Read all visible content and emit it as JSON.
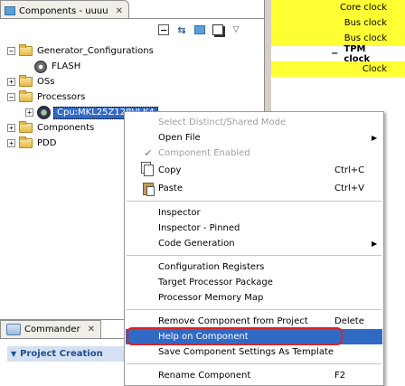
{
  "components_view": {
    "tab_title": "Components - uuuu",
    "close_glyph": "✕",
    "toolbar": [
      {
        "icon": "collapse-all-icon"
      },
      {
        "icon": "link-with-editor-icon",
        "glyph": "⇆"
      },
      {
        "icon": "new-folder-icon"
      },
      {
        "icon": "stack-icon"
      },
      {
        "icon": "view-menu-icon",
        "glyph": "▽"
      }
    ],
    "tree": [
      {
        "label": "Generator_Configurations",
        "expander": "−",
        "icon": "folder-icon",
        "level": 0
      },
      {
        "label": "FLASH",
        "expander": "",
        "icon": "gear-icon",
        "level": 1
      },
      {
        "label": "OSs",
        "expander": "+",
        "icon": "folder-icon",
        "level": 0
      },
      {
        "label": "Processors",
        "expander": "−",
        "icon": "folder-icon",
        "level": 0
      },
      {
        "label": "Cpu:MKL25Z128VLK4",
        "expander": "+",
        "icon": "cpu-icon",
        "level": 1,
        "selected": true
      },
      {
        "label": "Components",
        "expander": "+",
        "icon": "folder-icon",
        "level": 0
      },
      {
        "label": "PDD",
        "expander": "+",
        "icon": "folder-icon",
        "level": 0
      }
    ]
  },
  "editor": {
    "rows": [
      {
        "text": "Core clock",
        "style": "yellow"
      },
      {
        "text": "Bus clock",
        "style": "yellow"
      },
      {
        "text": "Bus clock",
        "style": "yellow"
      },
      {
        "text": "TPM clock",
        "style": "header",
        "expander": "−"
      },
      {
        "text": "Clock",
        "style": "yellow"
      }
    ]
  },
  "commander": {
    "tab_title": "Commander",
    "close_glyph": "✕",
    "section_title": "Project Creation"
  },
  "context_menu": {
    "items": [
      {
        "label": "Select Distinct/Shared Mode",
        "disabled": true
      },
      {
        "label": "Open File",
        "submenu": true
      },
      {
        "label": "Component Enabled",
        "disabled": true,
        "checked": true
      },
      {
        "label": "Copy",
        "shortcut": "Ctrl+C",
        "icon": "copy-icon"
      },
      {
        "label": "Paste",
        "shortcut": "Ctrl+V",
        "icon": "paste-icon"
      },
      {
        "separator": true
      },
      {
        "label": "Inspector"
      },
      {
        "label": "Inspector - Pinned"
      },
      {
        "label": "Code Generation",
        "submenu": true
      },
      {
        "separator": true
      },
      {
        "label": "Configuration Registers"
      },
      {
        "label": "Target Processor Package"
      },
      {
        "label": "Processor Memory Map"
      },
      {
        "separator": true
      },
      {
        "label": "Remove Component from Project",
        "shortcut": "Delete"
      },
      {
        "label": "Help on Component",
        "selected": true
      },
      {
        "label": "Save Component Settings As Template"
      },
      {
        "separator": true
      },
      {
        "label": "Rename Component",
        "shortcut": "F2"
      }
    ],
    "highlight_color": "#d8252a",
    "selection_color": "#316ac5"
  }
}
